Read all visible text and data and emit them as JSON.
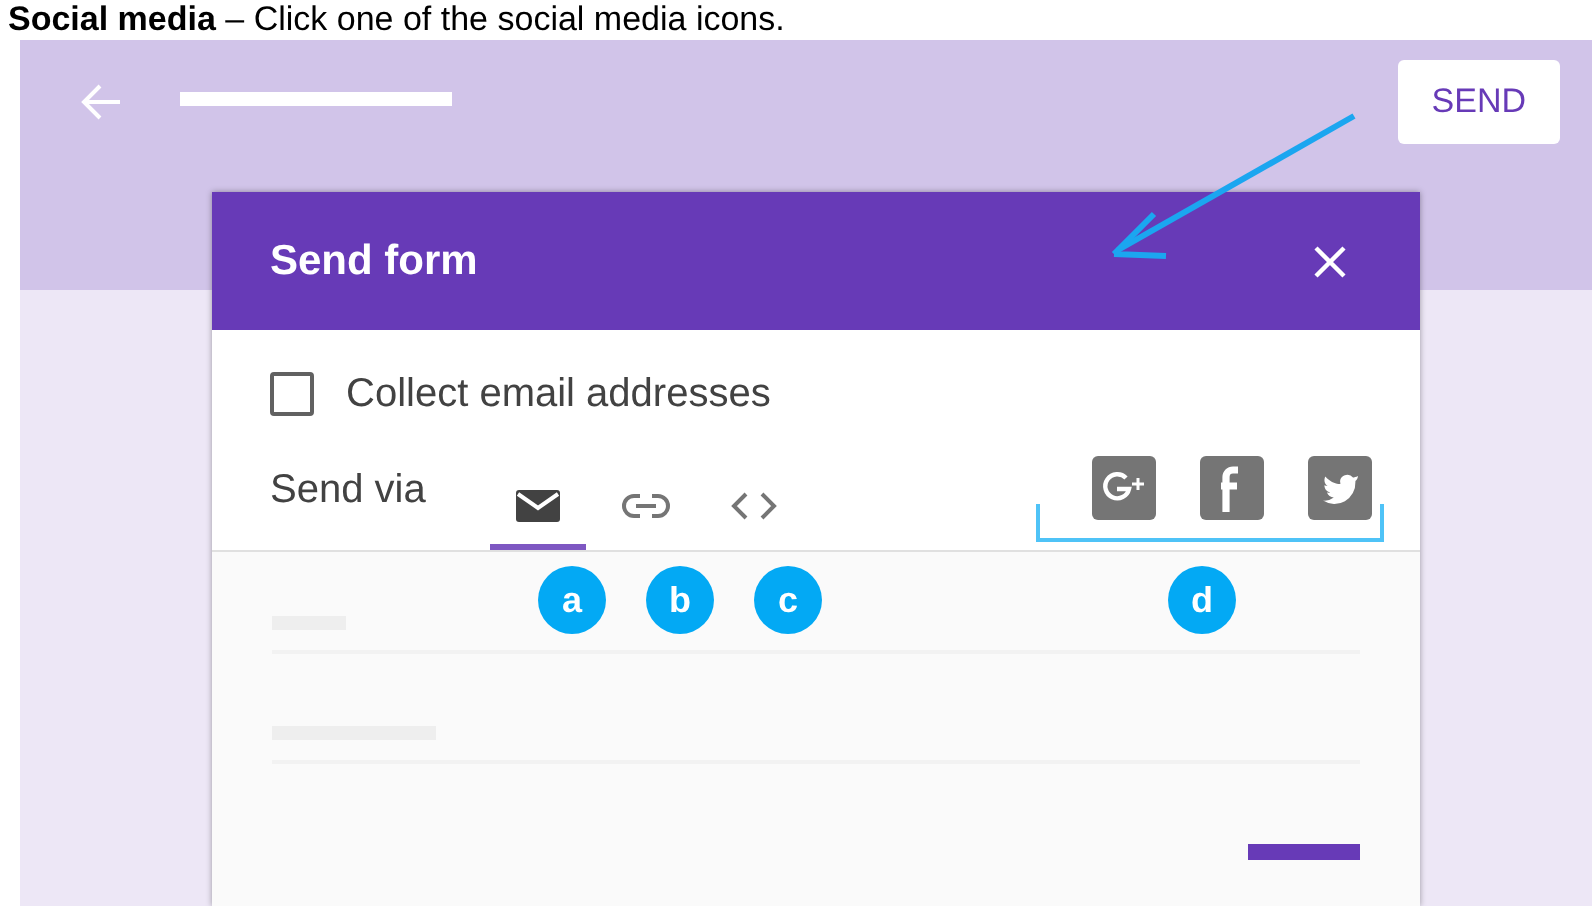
{
  "caption": "**Social media** – Click one of the social media icons.",
  "app_bar": {
    "send_button": "SEND"
  },
  "dialog": {
    "title": "Send form",
    "collect_email": {
      "label": "Collect email addresses",
      "checked": false
    },
    "send_via": {
      "label": "Send via",
      "methods": [
        {
          "kind": "email",
          "selected": true
        },
        {
          "kind": "link",
          "selected": false
        },
        {
          "kind": "embed",
          "selected": false
        }
      ],
      "social": [
        {
          "kind": "google-plus"
        },
        {
          "kind": "facebook"
        },
        {
          "kind": "twitter"
        }
      ]
    }
  },
  "callouts": [
    "a",
    "b",
    "c",
    "d"
  ]
}
